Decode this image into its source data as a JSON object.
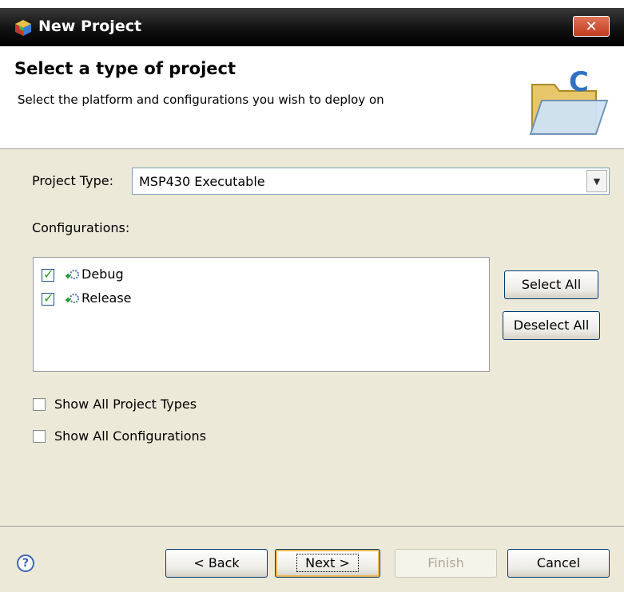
{
  "window": {
    "title": "New Project",
    "close_glyph": "✕"
  },
  "header": {
    "title": "Select a type of project",
    "subtitle": "Select the platform and configurations you wish to deploy on",
    "icon": "folder-icon"
  },
  "project_type": {
    "label": "Project Type:",
    "value": "MSP430 Executable"
  },
  "configurations": {
    "label": "Configurations:",
    "items": [
      {
        "label": "Debug",
        "checked": true
      },
      {
        "label": "Release",
        "checked": true
      }
    ],
    "select_all_label": "Select All",
    "deselect_all_label": "Deselect All"
  },
  "options": {
    "show_all_project_types": {
      "label": "Show All Project Types",
      "checked": false
    },
    "show_all_configurations": {
      "label": "Show All Configurations",
      "checked": false
    }
  },
  "footer": {
    "back_label": "< Back",
    "next_label": "Next >",
    "finish_label": "Finish",
    "cancel_label": "Cancel",
    "help_glyph": "?"
  }
}
